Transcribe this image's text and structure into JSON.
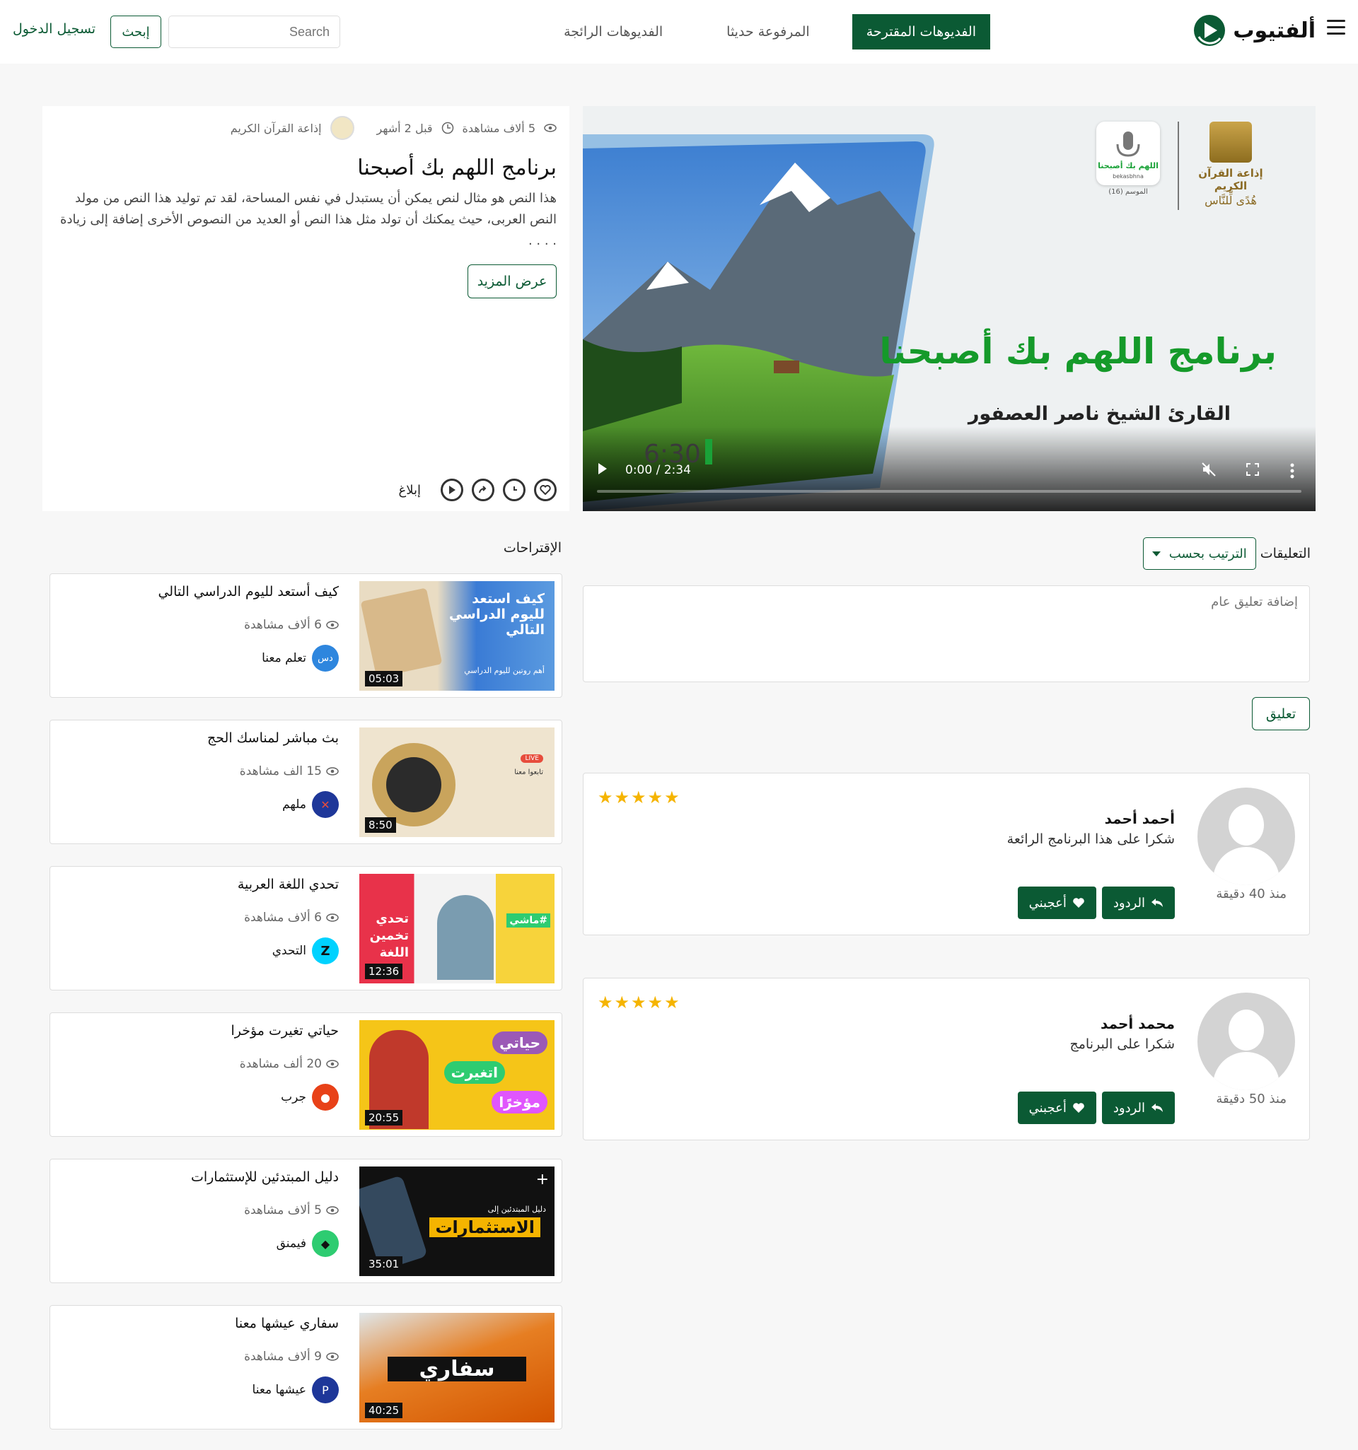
{
  "nav": {
    "logo_text": "ألفتيوب",
    "tabs": [
      "الفديوهات المقترحة",
      "المرفوعة حديثا",
      "الفديوهات الرائجة"
    ],
    "search_placeholder": "Search",
    "search_button": "إبحث",
    "login": "تسجيل الدخول"
  },
  "video": {
    "title_overlay": "برنامج اللهم بك أصبحنا",
    "reader_overlay": "القارئ الشيخ ناصر العصفور",
    "radio_name": "إذاعة القرآن الكريم",
    "radio_sub": "هُدًى لِّلنَّاس",
    "podcast_name": "اللهم بك أصبحنا",
    "podcast_handle": "bekasbhna",
    "podcast_season": "الموسم (16)",
    "clock": "6:30",
    "time": "0:00 / 2:34"
  },
  "info": {
    "views": "5 ألاف مشاهدة",
    "ago": "قبل 2 أشهر",
    "channel": "إذاعة القرآن الكريم",
    "title": "برنامج اللهم بك أصبحنا",
    "description": "هذا النص هو مثال لنص يمكن أن يستبدل في نفس المساحة، لقد تم توليد هذا النص من مولد النص العربى، حيث يمكنك أن تولد مثل هذا النص أو العديد من النصوص الأخرى إضافة إلى زيادة . . . .",
    "more_button": "عرض المزيد",
    "report": "إبلاغ"
  },
  "comments": {
    "label": "التعليقات",
    "sort_button": "الترتيب بحسب",
    "placeholder": "إضافة تعليق عام",
    "submit": "تعليق",
    "items": [
      {
        "name": "أحمد أحمد",
        "text": "شكرا على هذا البرنامج الرائعة",
        "time": "منذ 40 دقيقة",
        "rating": 5,
        "reply": "الردود",
        "like": "أعجبني"
      },
      {
        "name": "محمد أحمد",
        "text": "شكرا على البرنامج",
        "time": "منذ 50 دقيقة",
        "rating": 5,
        "reply": "الردود",
        "like": "أعجبني"
      }
    ]
  },
  "suggestions": {
    "label": "الإقتراحات",
    "items": [
      {
        "title": "كيف أستعد لليوم الدراسي التالي",
        "views": "6 ألاف مشاهدة",
        "channel": "تعلم معنا",
        "duration": "05:03",
        "thumb_text": "كيف استعد لليوم الدراسي التالي",
        "thumb_sub": "أهم روتين لليوم الدراسي",
        "avatar_text": "دس",
        "color": "#2e86de"
      },
      {
        "title": "بث مباشر لمناسك الحج",
        "views": "15 الف مشاهدة",
        "channel": "ملهم",
        "duration": "8:50",
        "thumb_text": "LIVE",
        "thumb_sub": "تابعوا معنا",
        "avatar_text": "✕",
        "color": "#1e3799"
      },
      {
        "title": "تحدي اللغة العربية",
        "views": "6 ألاف مشاهدة",
        "channel": "التحدي",
        "duration": "12:36",
        "thumb_text": "تحدي تخمين اللغة",
        "thumb_sub": "#ماشي",
        "avatar_text": "Z",
        "color": "#00d2ff"
      },
      {
        "title": "حياتي تغيرت مؤخرا",
        "views": "20 ألف مشاهدة",
        "channel": "جرب",
        "duration": "20:55",
        "thumb_text": "حياتي",
        "thumb_sub": "اتغيرت",
        "thumb_sub2": "مؤخرًا",
        "avatar_text": "●",
        "color": "#e84118"
      },
      {
        "title": "دليل المبتدئين للإستثمارات",
        "views": "5 ألاف مشاهدة",
        "channel": "فيمنق",
        "duration": "35:01",
        "thumb_text": "الاستثمارات",
        "thumb_sub": "دليل المبتدئين إلى",
        "avatar_text": "◆",
        "color": "#2ecc71"
      },
      {
        "title": "سفاري عيشها معنا",
        "views": "9 ألاف مشاهدة",
        "channel": "عيشها معنا",
        "duration": "40:25",
        "thumb_text": "سفاري",
        "avatar_text": "P",
        "color": "#1e3799"
      }
    ]
  },
  "colors": {
    "brand": "#0b5a34",
    "star": "#f5b400",
    "overlay_green": "#159a2a"
  }
}
